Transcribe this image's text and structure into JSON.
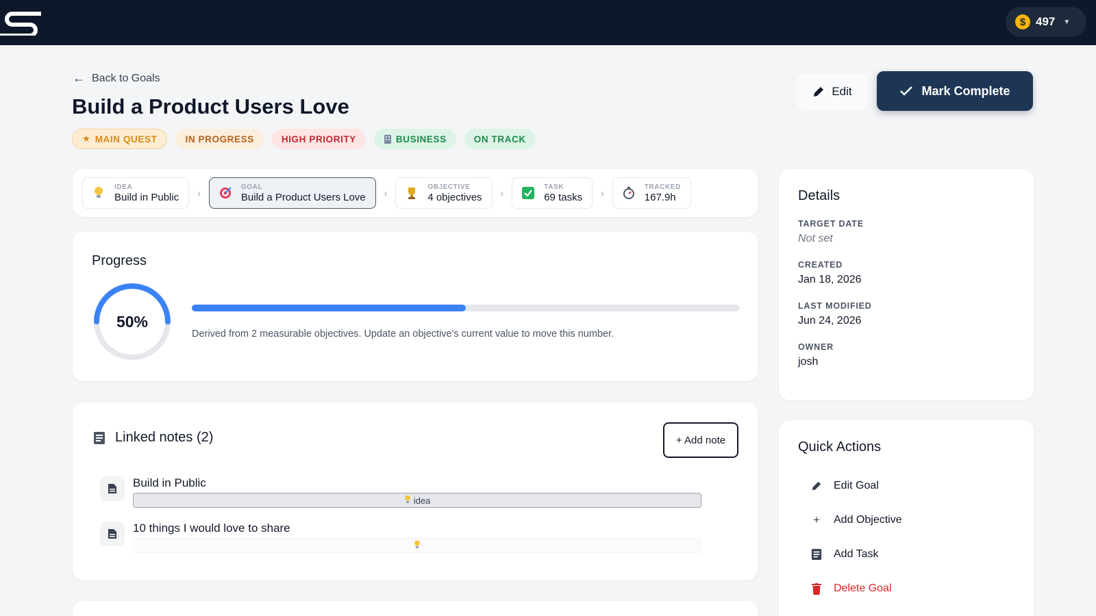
{
  "topbar": {
    "coins": "497"
  },
  "header": {
    "back_label": "Back to Goals",
    "title": "Build a Product Users Love",
    "badges": [
      "MAIN QUEST",
      "IN PROGRESS",
      "HIGH PRIORITY",
      "BUSINESS",
      "ON TRACK"
    ],
    "edit_label": "Edit",
    "complete_label": "Mark Complete"
  },
  "chain": [
    {
      "kind": "IDEA",
      "value": "Build in Public",
      "icon": "lightbulb-icon"
    },
    {
      "kind": "GOAL",
      "value": "Build a Product Users Love",
      "icon": "target-icon"
    },
    {
      "kind": "OBJECTIVE",
      "value": "4 objectives",
      "icon": "trophy-icon"
    },
    {
      "kind": "TASK",
      "value": "69 tasks",
      "icon": "checkbox-icon"
    },
    {
      "kind": "TRACKED",
      "value": "167.9h",
      "icon": "stopwatch-icon"
    }
  ],
  "progress": {
    "title": "Progress",
    "percent_label": "50%",
    "value": 0.5,
    "description": "Derived from 2 measurable objectives. Update an objective's current value to move this number."
  },
  "notes": {
    "title": "Linked notes (2)",
    "add_label": "+ Add note",
    "items": [
      {
        "title": "Build in Public",
        "tag": "idea"
      },
      {
        "title": "10 things I would love to share",
        "tag": ""
      }
    ]
  },
  "details": {
    "title": "Details",
    "target_label": "TARGET DATE",
    "target_value": "Not set",
    "created_label": "CREATED",
    "created_value": "Jan 18, 2026",
    "modified_label": "LAST MODIFIED",
    "modified_value": "Jun 24, 2026",
    "owner_label": "OWNER",
    "owner_value": "josh"
  },
  "quick_actions": {
    "title": "Quick Actions",
    "items": [
      "Edit Goal",
      "Add Objective",
      "Add Task",
      "Delete Goal"
    ]
  },
  "colors": {
    "accent": "#3b82f6",
    "primary_button": "#1e3656",
    "danger": "#dc2626",
    "topbar": "#0f172a"
  }
}
